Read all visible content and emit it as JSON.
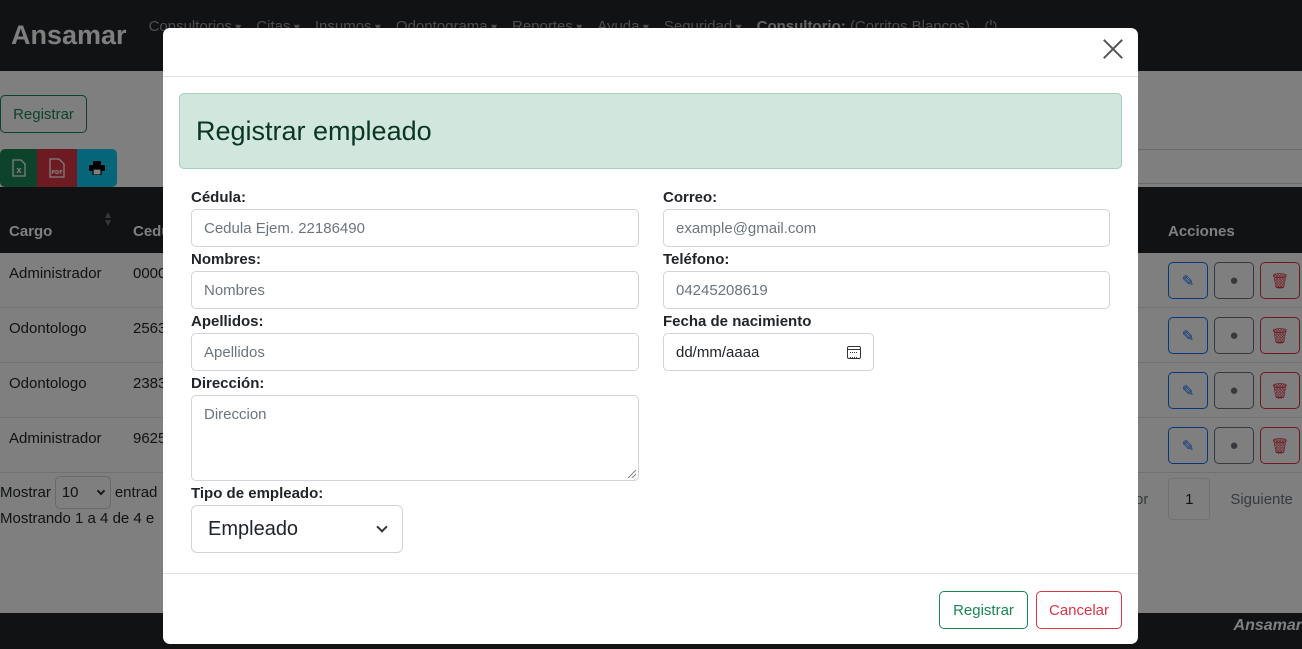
{
  "navbar": {
    "brand": "Ansamar",
    "menu": [
      {
        "label": "Consultorios",
        "caret": true
      },
      {
        "label": "Citas",
        "caret": true
      },
      {
        "label": "Insumos",
        "caret": true
      },
      {
        "label": "Odontograma",
        "caret": true
      },
      {
        "label": "Reportes",
        "caret": true
      },
      {
        "label": "Ayuda",
        "caret": true
      },
      {
        "label": "Seguridad",
        "caret": true
      }
    ],
    "consultorio_label": "Consultorio:",
    "consultorio_value": "(Corritos Blancos)",
    "power_icon": "power-icon"
  },
  "page": {
    "register_button": "Registrar",
    "export": {
      "excel_icon": "excel-icon",
      "pdf_icon": "pdf-icon",
      "print_icon": "print-icon"
    },
    "table": {
      "headers": {
        "cargo": "Cargo",
        "cedula": "Cedu",
        "acciones": "Acciones"
      },
      "rows": [
        {
          "cargo": "Administrador",
          "cedula": "0000"
        },
        {
          "cargo": "Odontologo",
          "cedula": "2563"
        },
        {
          "cargo": "Odontologo",
          "cedula": "2383"
        },
        {
          "cargo": "Administrador",
          "cedula": "9625"
        }
      ]
    },
    "show_label": "Mostrar",
    "entries_value": "10",
    "entries_suffix": "entrad",
    "info_text": "Mostrando 1 a 4 de 4 e",
    "pager": {
      "previous_partial": "or",
      "current_page": "1",
      "next": "Siguiente"
    },
    "footer_brand": "Ansamar"
  },
  "modal": {
    "close_icon": "close-icon",
    "title": "Registrar empleado",
    "fields": {
      "cedula": {
        "label": "Cédula:",
        "placeholder": "Cedula Ejem. 22186490"
      },
      "correo": {
        "label": "Correo:",
        "placeholder": "example@gmail.com"
      },
      "nombres": {
        "label": "Nombres:",
        "placeholder": "Nombres"
      },
      "telefono": {
        "label": "Teléfono:",
        "placeholder": "04245208619"
      },
      "apellidos": {
        "label": "Apellidos:",
        "placeholder": "Apellidos"
      },
      "fecha": {
        "label": "Fecha de nacimiento",
        "value": "dd/mm/aaaa"
      },
      "direccion": {
        "label": "Dirección:",
        "placeholder": "Direccion"
      },
      "tipo": {
        "label": "Tipo de empleado:",
        "value": "Empleado"
      }
    },
    "footer": {
      "submit": "Registrar",
      "cancel": "Cancelar"
    }
  },
  "colors": {
    "success": "#198754",
    "danger": "#dc3545",
    "primary": "#0d6efd",
    "info": "#0dcaf0",
    "dark": "#212529",
    "alert_bg": "#d1e7dd"
  }
}
